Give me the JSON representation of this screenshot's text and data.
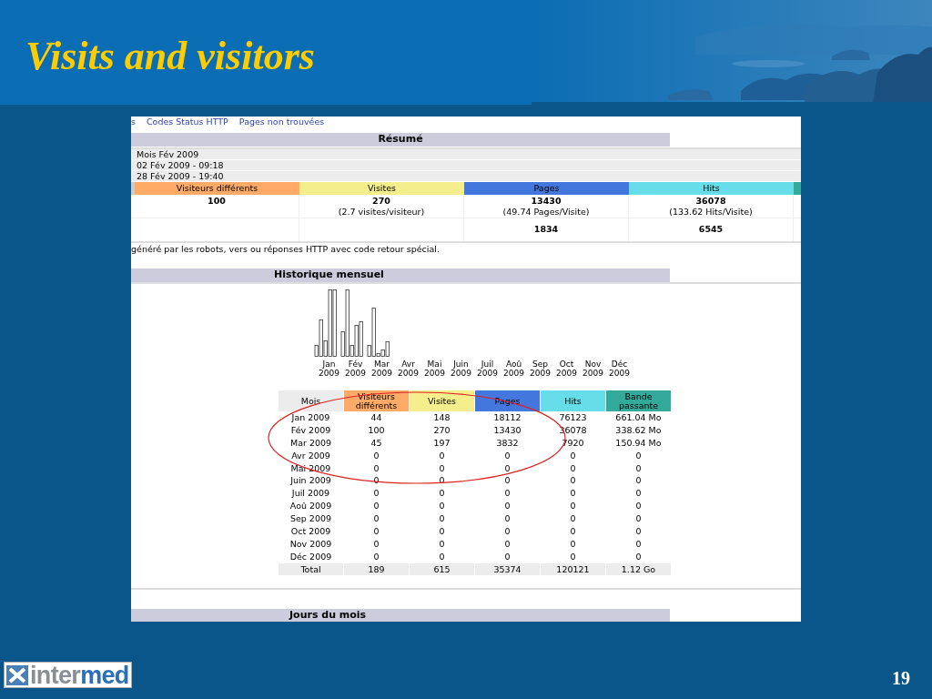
{
  "slide": {
    "title": "Visits and visitors",
    "page_number": "19",
    "logo": {
      "prefix": "inter",
      "suffix": "med"
    }
  },
  "screenshot": {
    "nav_links": [
      "s",
      "Codes Status HTTP",
      "Pages non trouvées"
    ],
    "summary": {
      "title": "Résumé",
      "info_rows": [
        "Mois Fév 2009",
        "02 Fév 2009 - 09:18",
        "28 Fév 2009 - 19:40"
      ],
      "columns": [
        {
          "label": "Visiteurs différents",
          "color": "#ffaa66",
          "main": "100"
        },
        {
          "label": "Visites",
          "color": "#f4ef8c",
          "main": "270",
          "sub": "(2.7 visites/visiteur)"
        },
        {
          "label": "Pages",
          "color": "#4477dd",
          "main": "13430",
          "sub": "(49.74 Pages/Visite)",
          "extra": "1834"
        },
        {
          "label": "Hits",
          "color": "#66dde8",
          "main": "36078",
          "sub": "(133.62 Hits/Visite)",
          "extra": "6545"
        }
      ],
      "note": "généré par les robots, vers ou réponses HTTP avec code retour spécial."
    },
    "monthly": {
      "title": "Historique mensuel",
      "chart_labels": [
        {
          "month": "Jan",
          "year": "2009"
        },
        {
          "month": "Fév",
          "year": "2009"
        },
        {
          "month": "Mar",
          "year": "2009"
        },
        {
          "month": "Avr",
          "year": "2009"
        },
        {
          "month": "Mai",
          "year": "2009"
        },
        {
          "month": "Juin",
          "year": "2009"
        },
        {
          "month": "Juil",
          "year": "2009"
        },
        {
          "month": "Aoû",
          "year": "2009"
        },
        {
          "month": "Sep",
          "year": "2009"
        },
        {
          "month": "Oct",
          "year": "2009"
        },
        {
          "month": "Nov",
          "year": "2009"
        },
        {
          "month": "Déc",
          "year": "2009"
        }
      ],
      "table": {
        "columns": [
          {
            "label": "Mois",
            "color": "#ececec"
          },
          {
            "label": "Visiteurs différents",
            "color": "#ffaa66"
          },
          {
            "label": "Visites",
            "color": "#f4ef8c"
          },
          {
            "label": "Pages",
            "color": "#4477dd"
          },
          {
            "label": "Hits",
            "color": "#66dde8"
          },
          {
            "label": "Bande passante",
            "color": "#33aa99"
          }
        ],
        "rows": [
          [
            "Jan 2009",
            "44",
            "148",
            "18112",
            "76123",
            "661.04 Mo"
          ],
          [
            "Fév 2009",
            "100",
            "270",
            "13430",
            "36078",
            "338.62 Mo"
          ],
          [
            "Mar 2009",
            "45",
            "197",
            "3832",
            "7920",
            "150.94 Mo"
          ],
          [
            "Avr 2009",
            "0",
            "0",
            "0",
            "0",
            "0"
          ],
          [
            "Mai 2009",
            "0",
            "0",
            "0",
            "0",
            "0"
          ],
          [
            "Juin 2009",
            "0",
            "0",
            "0",
            "0",
            "0"
          ],
          [
            "Juil 2009",
            "0",
            "0",
            "0",
            "0",
            "0"
          ],
          [
            "Aoû 2009",
            "0",
            "0",
            "0",
            "0",
            "0"
          ],
          [
            "Sep 2009",
            "0",
            "0",
            "0",
            "0",
            "0"
          ],
          [
            "Oct 2009",
            "0",
            "0",
            "0",
            "0",
            "0"
          ],
          [
            "Nov 2009",
            "0",
            "0",
            "0",
            "0",
            "0"
          ],
          [
            "Déc 2009",
            "0",
            "0",
            "0",
            "0",
            "0"
          ]
        ],
        "total": [
          "Total",
          "189",
          "615",
          "35374",
          "120121",
          "1.12 Go"
        ]
      }
    },
    "annotation": {
      "kind": "ellipse"
    },
    "next_section": {
      "title": "Jours du mois"
    }
  }
}
